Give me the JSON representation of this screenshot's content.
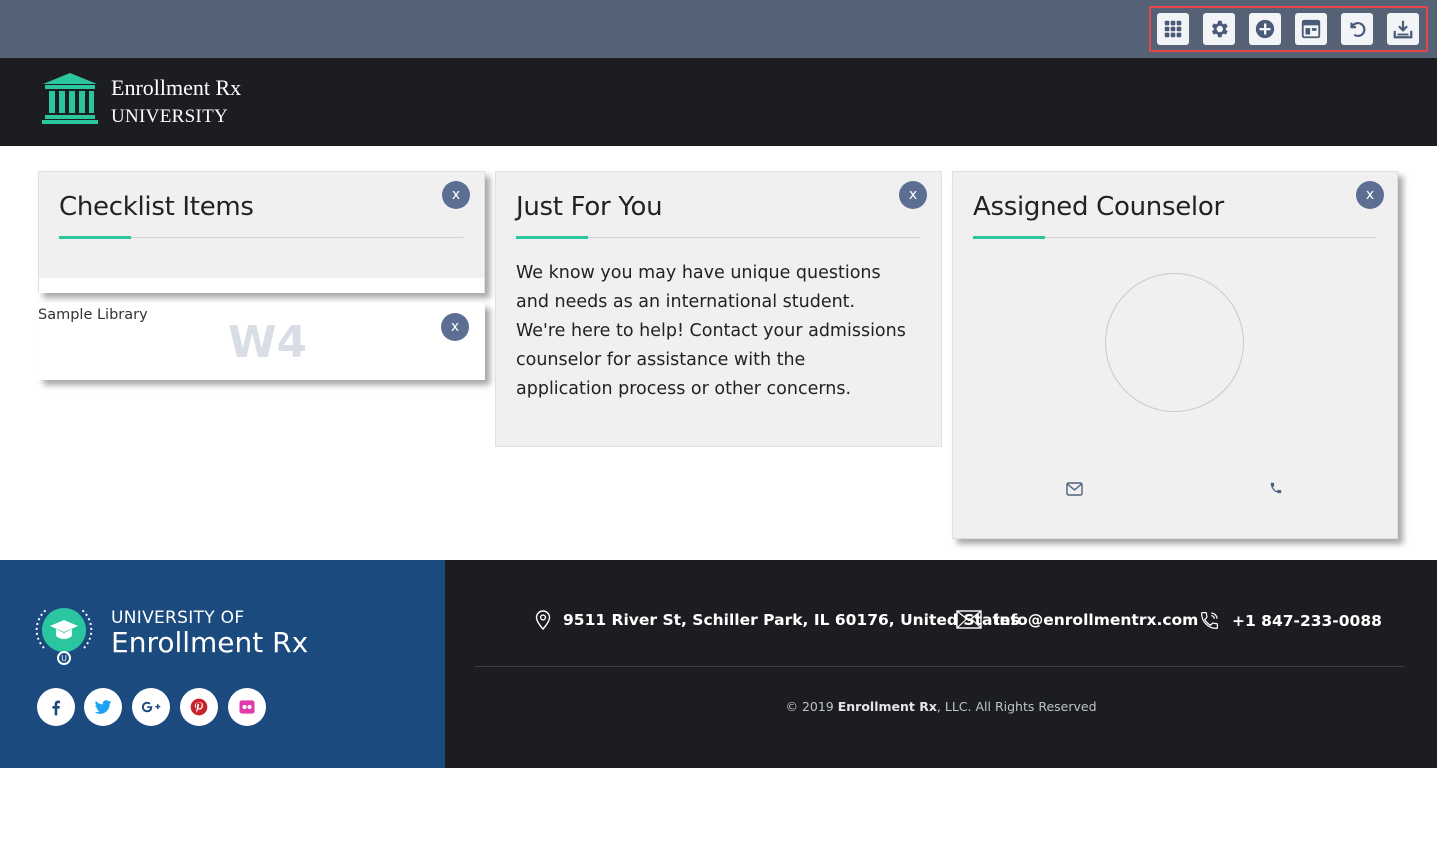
{
  "toolbar": {
    "buttons": [
      {
        "icon": "apps-grid-icon"
      },
      {
        "icon": "gear-icon"
      },
      {
        "icon": "add-circle-icon"
      },
      {
        "icon": "layout-icon"
      },
      {
        "icon": "undo-icon"
      },
      {
        "icon": "download-icon"
      }
    ],
    "highlight_color": "#e8454c"
  },
  "header": {
    "brand_line1": "Enrollment Rx",
    "brand_line2": "UNIVERSITY",
    "brand_icon": "columns-building-icon",
    "accent_color": "#2bc6a0"
  },
  "cards": {
    "checklist": {
      "title": "Checklist Items",
      "close": "x"
    },
    "library": {
      "label": "Sample Library",
      "watermark": "W4",
      "close": "x"
    },
    "just_for_you": {
      "title": "Just For You",
      "close": "x",
      "body": "We know you may have unique questions and needs as an international student. We're here to help! Contact your admissions counselor for assistance with the application process or other concerns."
    },
    "counselor": {
      "title": "Assigned Counselor",
      "close": "x",
      "email_icon": "envelope-icon",
      "phone_icon": "phone-icon"
    }
  },
  "footer": {
    "university_of": "UNIVERSITY OF",
    "university_name": "Enrollment Rx",
    "social": [
      "facebook-icon",
      "twitter-icon",
      "google-plus-icon",
      "pinterest-icon",
      "flickr-icon"
    ],
    "address": "9511 River St, Schiller Park, IL 60176, United States",
    "email": "info@enrollmentrx.com",
    "phone": "+1 847-233-0088",
    "copyright_prefix": "© 2019 ",
    "copyright_brand": "Enrollment Rx",
    "copyright_suffix": ", LLC. All Rights Reserved",
    "left_bg": "#1a4a7e",
    "right_bg": "#1c1d20"
  }
}
